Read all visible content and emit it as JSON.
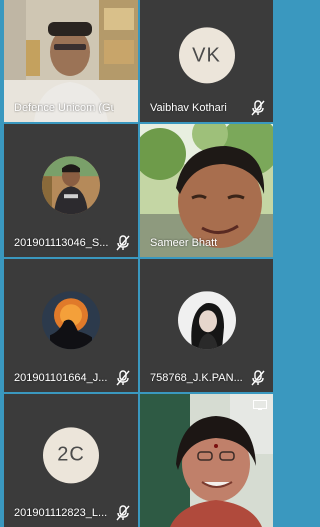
{
  "participants": [
    {
      "name": "Defence Unicom (Gu...",
      "type": "video",
      "muted": false
    },
    {
      "name": "Vaibhav Kothari",
      "type": "initials",
      "initials": "VK",
      "muted": true
    },
    {
      "name": "201901113046_S...",
      "type": "avatar",
      "muted": true
    },
    {
      "name": "Sameer Bhatt",
      "type": "video",
      "muted": false
    },
    {
      "name": "201901101664_J...",
      "type": "avatar",
      "muted": true
    },
    {
      "name": "758768_J.K.PAN...",
      "type": "avatar",
      "muted": true
    },
    {
      "name": "201901112823_L...",
      "type": "initials",
      "initials": "2C",
      "muted": true
    },
    {
      "name": "",
      "type": "video",
      "muted": false
    }
  ],
  "icons": {
    "mic_muted": "mic-off-icon",
    "screen_share": "screen-share-icon"
  },
  "colors": {
    "background": "#3a98bf",
    "tile": "#3b3b3b",
    "avatar_bg": "#ece5da"
  }
}
